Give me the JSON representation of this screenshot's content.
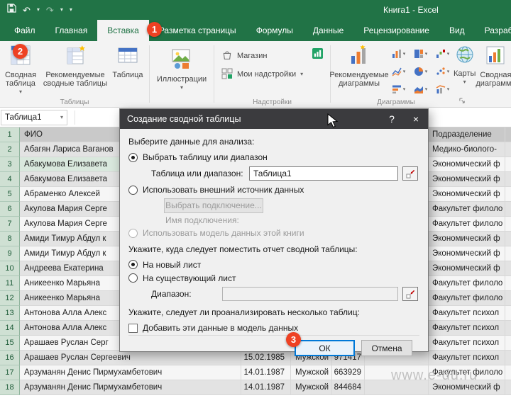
{
  "title_bar": {
    "title": "Книга1 - Excel"
  },
  "icons": {
    "caret": "▾",
    "close": "×",
    "help": "?",
    "undo": "↶",
    "redo": "↷"
  },
  "colors": {
    "excel_green": "#217346",
    "badge_red": "#ee4123",
    "focus_blue": "#0078d7",
    "dialog_titlebar": "#3b3b3e"
  },
  "ribbon": {
    "tabs": [
      {
        "label": "Файл",
        "name": "file"
      },
      {
        "label": "Главная",
        "name": "home"
      },
      {
        "label": "Вставка",
        "name": "insert",
        "active": true
      },
      {
        "label": "Разметка страницы",
        "name": "page-layout"
      },
      {
        "label": "Формулы",
        "name": "formulas"
      },
      {
        "label": "Данные",
        "name": "data"
      },
      {
        "label": "Рецензирование",
        "name": "review"
      },
      {
        "label": "Вид",
        "name": "view"
      },
      {
        "label": "Разработчик",
        "name": "developer"
      }
    ],
    "groups": {
      "tables": {
        "label": "Таблицы",
        "pivot": "Сводная таблица",
        "recommended": "Рекомендуемые сводные таблицы",
        "table": "Таблица"
      },
      "illustrations": {
        "button": "Иллюстрации"
      },
      "addins": {
        "label": "Надстройки",
        "store": "Магазин",
        "my_addins": "Мои надстройки"
      },
      "charts": {
        "label": "Диаграммы",
        "recommended": "Рекомендуемые диаграммы",
        "maps": "Карты",
        "pivot_chart": "Сводная диаграмма"
      }
    }
  },
  "formula_bar": {
    "name_box": "Таблица1"
  },
  "dialog": {
    "title": "Создание сводной таблицы",
    "section_data": "Выберите данные для анализа:",
    "radio_select_table": "Выбрать таблицу или диапазон",
    "label_table_range": "Таблица или диапазон:",
    "table_range_value": "Таблица1",
    "radio_external": "Использовать внешний источник данных",
    "button_choose_connection": "Выбрать подключение...",
    "label_connection_name": "Имя подключения:",
    "radio_data_model": "Использовать модель данных этой книги",
    "section_where": "Укажите, куда следует поместить отчет сводной таблицы:",
    "radio_new_sheet": "На новый лист",
    "radio_existing_sheet": "На существующий лист",
    "label_location": "Диапазон:",
    "location_value": "",
    "section_multi": "Укажите, следует ли проанализировать несколько таблиц:",
    "checkbox_add_model": "Добавить эти данные в модель данных",
    "ok": "ОК",
    "cancel": "Отмена"
  },
  "sheet": {
    "header_row_num": "1",
    "columns": {
      "fio": "ФИО",
      "dept": "Подразделение"
    },
    "rows": [
      {
        "n": "2",
        "fio": "Абагян Лариса Ваганов",
        "date": "",
        "gender": "",
        "code": "",
        "dept": "Медико-биолого-"
      },
      {
        "n": "3",
        "fio": "Абакумова Елизавета",
        "date": "",
        "gender": "",
        "code": "",
        "dept": "Экономический ф"
      },
      {
        "n": "4",
        "fio": "Абакумова Елизавета",
        "date": "",
        "gender": "",
        "code": "",
        "dept": "Экономический ф"
      },
      {
        "n": "5",
        "fio": "Абраменко Алексей",
        "date": "",
        "gender": "",
        "code": "",
        "dept": "Экономический ф"
      },
      {
        "n": "6",
        "fio": "Акулова Мария Серге",
        "date": "",
        "gender": "",
        "code": "",
        "dept": "Факультет филоло"
      },
      {
        "n": "7",
        "fio": "Акулова Мария Серге",
        "date": "",
        "gender": "",
        "code": "",
        "dept": "Факультет филоло"
      },
      {
        "n": "8",
        "fio": "Амиди Тимур Абдул к",
        "date": "",
        "gender": "",
        "code": "",
        "dept": "Экономический ф"
      },
      {
        "n": "9",
        "fio": "Амиди Тимур Абдул к",
        "date": "",
        "gender": "",
        "code": "",
        "dept": "Экономический ф"
      },
      {
        "n": "10",
        "fio": "Андреева Екатерина",
        "date": "",
        "gender": "",
        "code": "",
        "dept": "Экономический ф"
      },
      {
        "n": "11",
        "fio": "Аникеенко Марьяна",
        "date": "",
        "gender": "",
        "code": "",
        "dept": "Факультет филоло"
      },
      {
        "n": "12",
        "fio": "Аникеенко Марьяна",
        "date": "",
        "gender": "",
        "code": "",
        "dept": "Факультет филоло"
      },
      {
        "n": "13",
        "fio": "Антонова Алла Алекс",
        "date": "",
        "gender": "",
        "code": "",
        "dept": "Факультет психол"
      },
      {
        "n": "14",
        "fio": "Антонова Алла Алекс",
        "date": "",
        "gender": "",
        "code": "",
        "dept": "Факультет психол"
      },
      {
        "n": "15",
        "fio": "Арашаев Руслан Серг",
        "date": "",
        "gender": "",
        "code": "",
        "dept": "Факультет психол"
      },
      {
        "n": "16",
        "fio": "Арашаев Руслан Сергеевич",
        "date": "15.02.1985",
        "gender": "Мужской",
        "code": "971417",
        "dept": "Факультет психол"
      },
      {
        "n": "17",
        "fio": "Арзуманян Денис Пирмухамбетович",
        "date": "14.01.1987",
        "gender": "Мужской",
        "code": "663929",
        "dept": "Факультет филоло"
      },
      {
        "n": "18",
        "fio": "Арзуманян Денис Пирмухамбетович",
        "date": "14.01.1987",
        "gender": "Мужской",
        "code": "844684",
        "dept": "Экономический ф"
      }
    ]
  },
  "badges": {
    "one": "1",
    "two": "2",
    "three": "3"
  },
  "watermark": "www.e-du.ru"
}
